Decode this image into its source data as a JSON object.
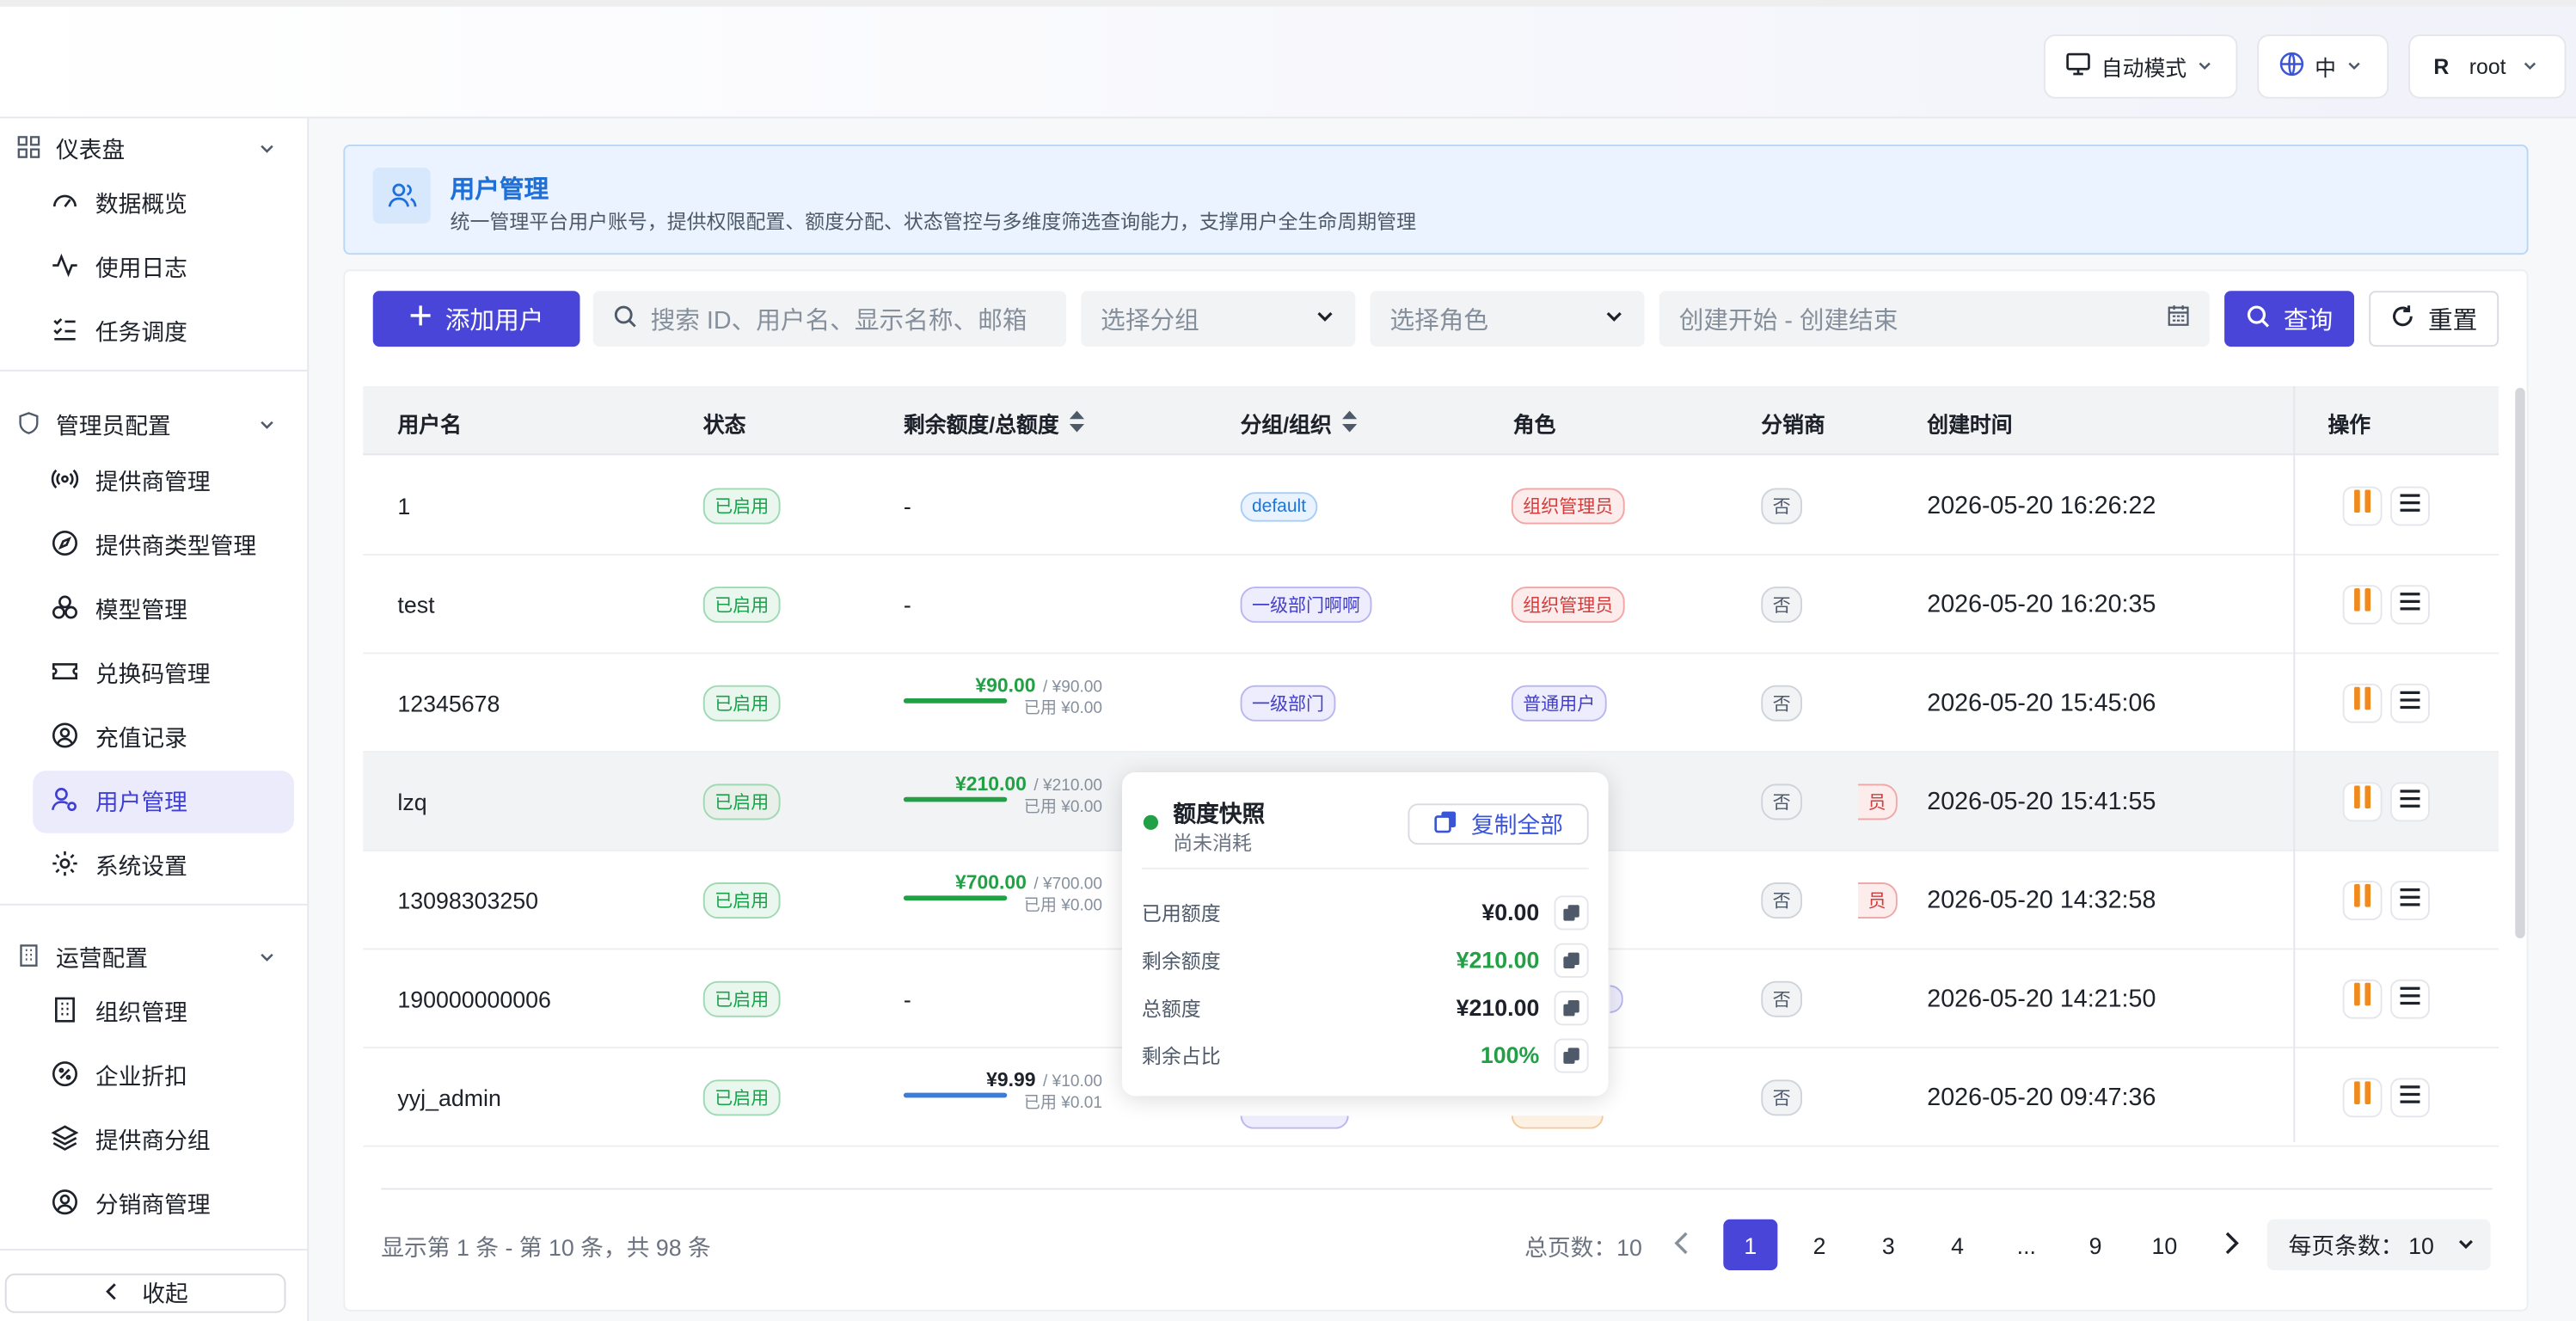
{
  "header": {
    "theme_label": "自动模式",
    "lang_label": "中",
    "avatar_letter": "R",
    "user_label": "root"
  },
  "sidebar": {
    "group_dashboard": "仪表盘",
    "dashboard_items": [
      "数据概览",
      "使用日志",
      "任务调度"
    ],
    "group_admin": "管理员配置",
    "admin_items": [
      "提供商管理",
      "提供商类型管理",
      "模型管理",
      "兑换码管理",
      "充值记录",
      "用户管理",
      "系统设置"
    ],
    "group_ops": "运营配置",
    "ops_items": [
      "组织管理",
      "企业折扣",
      "提供商分组",
      "分销商管理"
    ],
    "collapse_label": "收起",
    "active_item": "用户管理"
  },
  "banner": {
    "title": "用户管理",
    "description": "统一管理平台用户账号，提供权限配置、额度分配、状态管控与多维度筛选查询能力，支撑用户全生命周期管理"
  },
  "toolbar": {
    "add_label": "添加用户",
    "search_placeholder": "搜索 ID、用户名、显示名称、邮箱",
    "group_placeholder": "选择分组",
    "role_placeholder": "选择角色",
    "date_placeholder": "创建开始 - 创建结束",
    "query_label": "查询",
    "reset_label": "重置"
  },
  "table": {
    "columns": [
      "用户名",
      "状态",
      "剩余额度/总额度",
      "分组/组织",
      "角色",
      "分销商",
      "创建时间",
      "操作"
    ],
    "rows": [
      {
        "username": "1",
        "status": "已启用",
        "quota": null,
        "quota_text": "-",
        "group": "default",
        "role": "组织管理员",
        "distributor": "否",
        "created": "2026-05-20 16:26:22"
      },
      {
        "username": "test",
        "status": "已启用",
        "quota": null,
        "quota_text": "-",
        "group": "一级部门啊啊",
        "role": "组织管理员",
        "distributor": "否",
        "created": "2026-05-20 16:20:35"
      },
      {
        "username": "12345678",
        "status": "已启用",
        "quota": {
          "remain": "¥90.00",
          "total": "/ ¥90.00",
          "used": "已用 ¥0.00",
          "ratio": 1.0
        },
        "group": "一级部门",
        "role": "普通用户",
        "distributor": "否",
        "created": "2026-05-20 15:45:06"
      },
      {
        "username": "lzq",
        "status": "已启用",
        "quota": {
          "remain": "¥210.00",
          "total": "/ ¥210.00",
          "used": "已用 ¥0.00",
          "ratio": 1.0
        },
        "group": "",
        "role": "员",
        "distributor": "否",
        "created": "2026-05-20 15:41:55"
      },
      {
        "username": "13098303250",
        "status": "已启用",
        "quota": {
          "remain": "¥700.00",
          "total": "/ ¥700.00",
          "used": "已用 ¥0.00",
          "ratio": 1.0
        },
        "group": "",
        "role": "员",
        "distributor": "否",
        "created": "2026-05-20 14:32:58"
      },
      {
        "username": "190000000006",
        "status": "已启用",
        "quota": null,
        "quota_text": "-",
        "group": "",
        "role": "",
        "distributor": "否",
        "created": "2026-05-20 14:21:50"
      },
      {
        "username": "yyj_admin",
        "status": "已启用",
        "quota": {
          "remain": "¥9.99",
          "total": "/ ¥10.00",
          "used": "已用 ¥0.01",
          "ratio": 0.999
        },
        "group": "",
        "role": "",
        "distributor": "否",
        "created": "2026-05-20 09:47:36"
      }
    ]
  },
  "popover": {
    "title": "额度快照",
    "subtitle": "尚未消耗",
    "copy_all_label": "复制全部",
    "rows": [
      {
        "label": "已用额度",
        "value": "¥0.00"
      },
      {
        "label": "剩余额度",
        "value": "¥210.00"
      },
      {
        "label": "总额度",
        "value": "¥210.00"
      },
      {
        "label": "剩余占比",
        "value": "100%"
      }
    ]
  },
  "pagination": {
    "summary": "显示第 1 条 - 第 10 条，共 98 条",
    "total_pages_label": "总页数：10",
    "pages": [
      "1",
      "2",
      "3",
      "4",
      "...",
      "9",
      "10"
    ],
    "current_page": "1",
    "page_size_label": "每页条数：",
    "page_size_value": "10"
  },
  "colors": {
    "accent": "#4845d8",
    "success": "#22a045",
    "pause": "#f08a1c",
    "banner_title": "#1f6fd8"
  }
}
